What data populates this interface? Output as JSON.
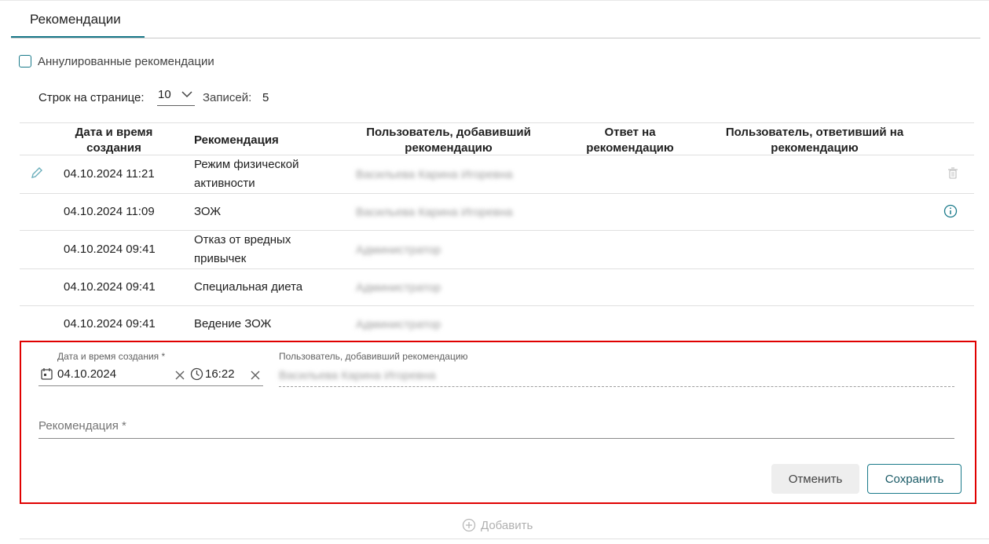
{
  "tab": {
    "label": "Рекомендации"
  },
  "filter": {
    "annulled_label": "Аннулированные рекомендации"
  },
  "pager": {
    "rows_label": "Строк на странице:",
    "rows_value": "10",
    "records_label": "Записей:",
    "records_count": "5"
  },
  "table": {
    "headers": {
      "date_line1": "Дата и время",
      "date_line2": "создания",
      "recommendation": "Рекомендация",
      "added_by_line1": "Пользователь, добавивший",
      "added_by_line2": "рекомендацию",
      "answer_line1": "Ответ на",
      "answer_line2": "рекомендацию",
      "answered_by_line1": "Пользователь, ответивший на",
      "answered_by_line2": "рекомендацию"
    },
    "rows": [
      {
        "datetime": "04.10.2024 11:21",
        "recommendation_line1": "Режим физической",
        "recommendation_line2": "активности",
        "added_by": "Васильева Карина Игоревна"
      },
      {
        "datetime": "04.10.2024 11:09",
        "recommendation_line1": "ЗОЖ",
        "added_by": "Васильева Карина Игоревна"
      },
      {
        "datetime": "04.10.2024 09:41",
        "recommendation_line1": "Отказ от вредных",
        "recommendation_line2": "привычек",
        "added_by": "Администратор"
      },
      {
        "datetime": "04.10.2024 09:41",
        "recommendation_line1": "Специальная диета",
        "added_by": "Администратор"
      },
      {
        "datetime": "04.10.2024 09:41",
        "recommendation_line1": "Ведение ЗОЖ",
        "added_by": "Администратор"
      }
    ]
  },
  "editor": {
    "date_label": "Дата и время создания *",
    "date_value": "04.10.2024",
    "time_value": "16:22",
    "user_label": "Пользователь, добавивший рекомендацию",
    "user_value": "Васильева Карина Игоревна",
    "recommendation_placeholder": "Рекомендация *",
    "cancel_label": "Отменить",
    "save_label": "Сохранить"
  },
  "add_label": "Добавить",
  "colors": {
    "accent": "#1a7a8a",
    "highlight_border": "#e00000"
  }
}
